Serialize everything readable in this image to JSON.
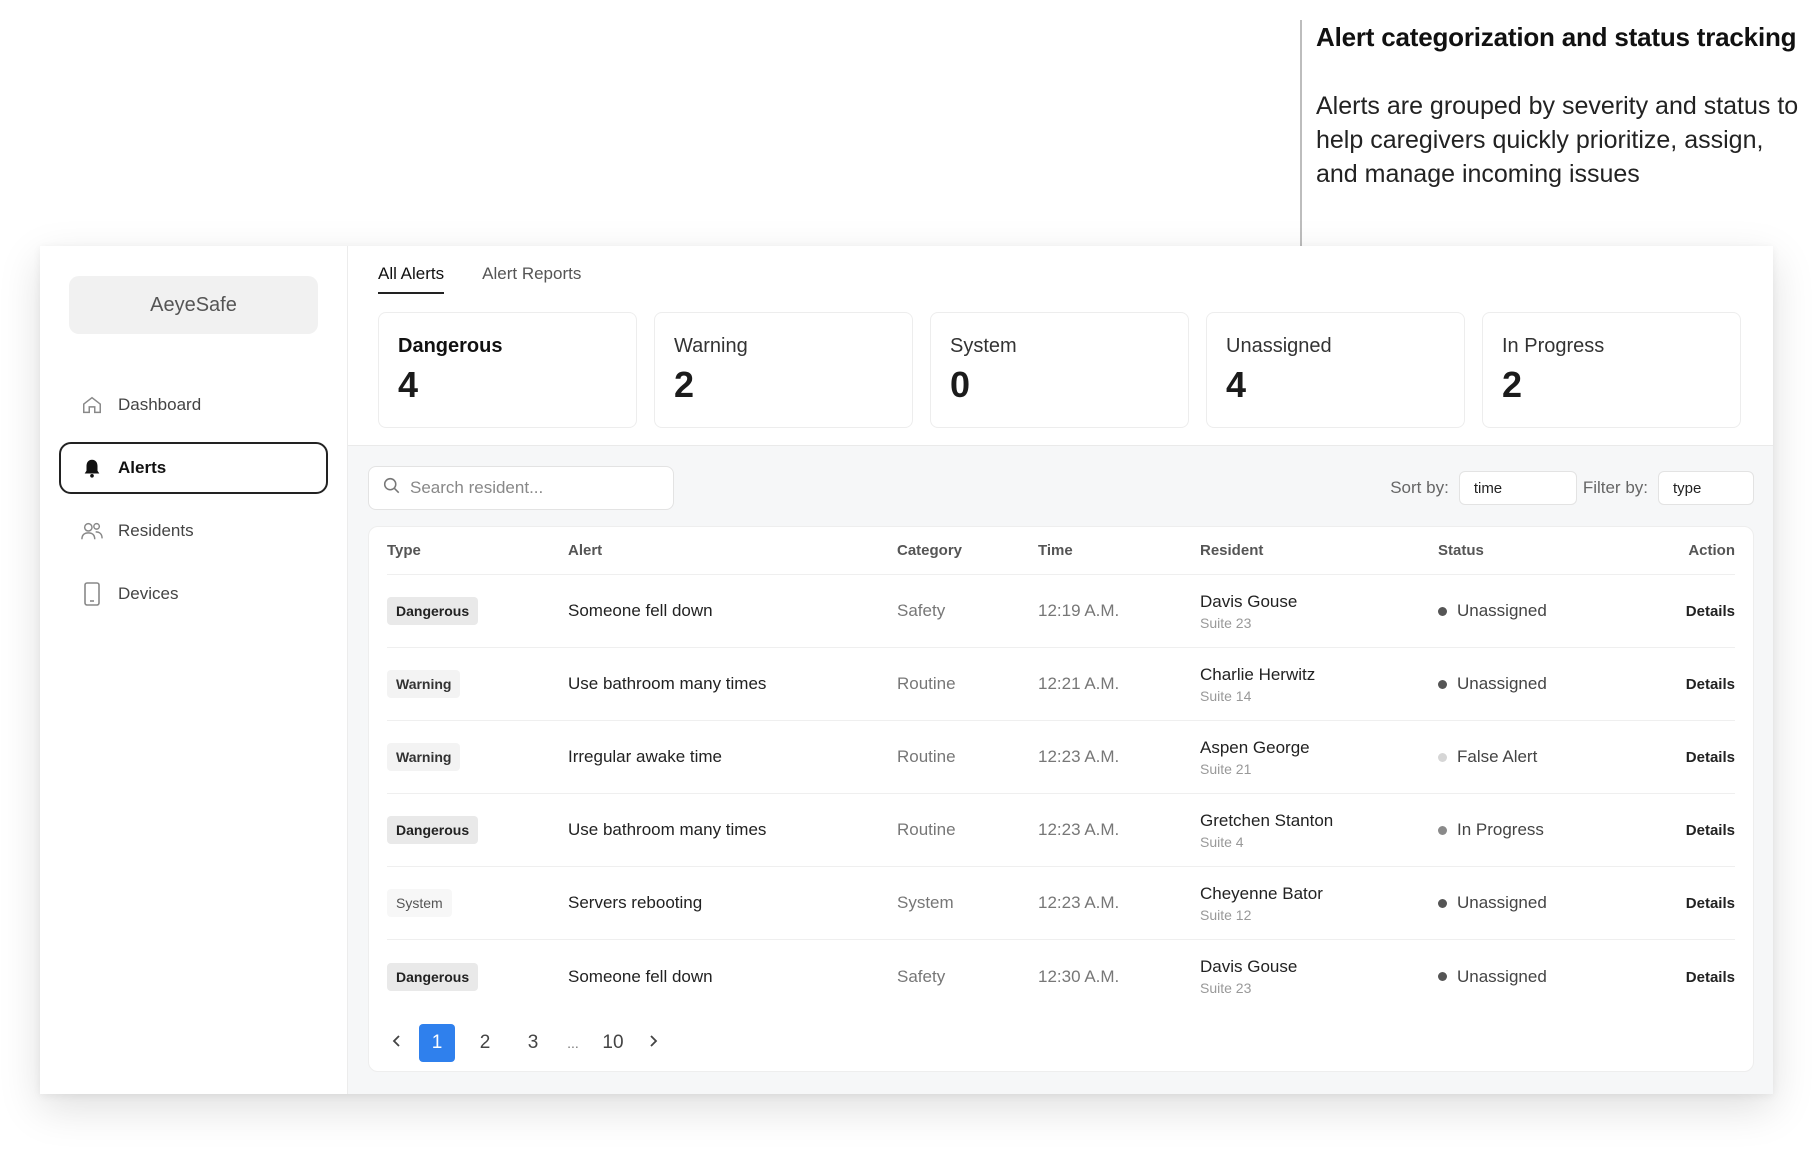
{
  "annotation": {
    "title": "Alert categorization and status tracking",
    "text": "Alerts are grouped by severity and status to help caregivers quickly prioritize, assign, and manage incoming issues"
  },
  "sidebar": {
    "logo": "AeyeSafe",
    "items": [
      {
        "label": "Dashboard",
        "icon": "home-icon",
        "active": false
      },
      {
        "label": "Alerts",
        "icon": "bell-icon",
        "active": true
      },
      {
        "label": "Residents",
        "icon": "users-icon",
        "active": false
      },
      {
        "label": "Devices",
        "icon": "device-icon",
        "active": false
      }
    ]
  },
  "tabs": [
    {
      "label": "All Alerts",
      "active": true
    },
    {
      "label": "Alert Reports",
      "active": false
    }
  ],
  "summary_cards": [
    {
      "label": "Dangerous",
      "value": "4"
    },
    {
      "label": "Warning",
      "value": "2"
    },
    {
      "label": "System",
      "value": "0"
    },
    {
      "label": "Unassigned",
      "value": "4"
    },
    {
      "label": "In Progress",
      "value": "2"
    }
  ],
  "toolbar": {
    "search_placeholder": "Search resident...",
    "sort_label": "Sort by:",
    "sort_value": "time",
    "filter_label": "Filter by:",
    "filter_value": "type"
  },
  "table": {
    "headers": [
      "Type",
      "Alert",
      "Category",
      "Time",
      "Resident",
      "Status",
      "Action"
    ],
    "rows": [
      {
        "type": "Dangerous",
        "alert": "Someone fell down",
        "category": "Safety",
        "time": "12:19 A.M.",
        "resident": "Davis Gouse",
        "suite": "Suite 23",
        "status": "Unassigned",
        "action": "Details"
      },
      {
        "type": "Warning",
        "alert": "Use bathroom many times",
        "category": "Routine",
        "time": "12:21 A.M.",
        "resident": "Charlie Herwitz",
        "suite": "Suite 14",
        "status": "Unassigned",
        "action": "Details"
      },
      {
        "type": "Warning",
        "alert": "Irregular awake time",
        "category": "Routine",
        "time": "12:23 A.M.",
        "resident": "Aspen George",
        "suite": "Suite 21",
        "status": "False Alert",
        "action": "Details"
      },
      {
        "type": "Dangerous",
        "alert": "Use bathroom many times",
        "category": "Routine",
        "time": "12:23 A.M.",
        "resident": "Gretchen Stanton",
        "suite": "Suite 4",
        "status": "In Progress",
        "action": "Details"
      },
      {
        "type": "System",
        "alert": "Servers rebooting",
        "category": "System",
        "time": "12:23 A.M.",
        "resident": "Cheyenne Bator",
        "suite": "Suite 12",
        "status": "Unassigned",
        "action": "Details"
      },
      {
        "type": "Dangerous",
        "alert": "Someone fell down",
        "category": "Safety",
        "time": "12:30 A.M.",
        "resident": "Davis Gouse",
        "suite": "Suite 23",
        "status": "Unassigned",
        "action": "Details"
      }
    ]
  },
  "pagination": {
    "pages": [
      "1",
      "2",
      "3",
      "...",
      "10"
    ],
    "current": "1"
  },
  "colors": {
    "accent": "#2f80ed",
    "status_unassigned": "#555555",
    "status_false_alert": "#d6d6d6",
    "status_in_progress": "#8a8a8a"
  }
}
